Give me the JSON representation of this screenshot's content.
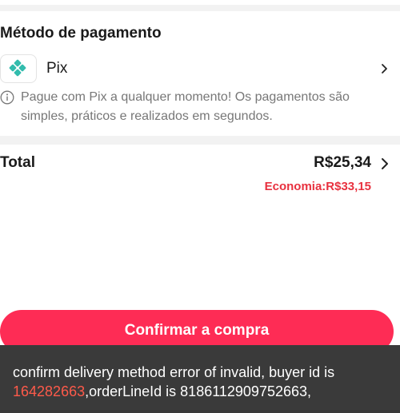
{
  "payment": {
    "title": "Método de pagamento",
    "method_name": "Pix",
    "method_icon": "pix-icon",
    "info_icon": "info-icon",
    "info_text": "Pague com Pix a qualquer momento! Os pagamentos são simples, práticos e realizados em segundos."
  },
  "summary": {
    "total_label": "Total",
    "total_value": "R$25,34",
    "savings": "Economia:R$33,15"
  },
  "actions": {
    "confirm_label": "Confirmar a compra"
  },
  "toast": {
    "prefix": "confirm delivery method error of invalid, buyer id is ",
    "buyer_id": "164282663",
    "suffix": ",orderLineId is 8186112909752663,"
  },
  "colors": {
    "accent": "#fe2c55",
    "savings": "#e8313f",
    "pix": "#32bcad",
    "toast_bg": "#3a3a3a",
    "toast_highlight": "#fe5a4a"
  }
}
